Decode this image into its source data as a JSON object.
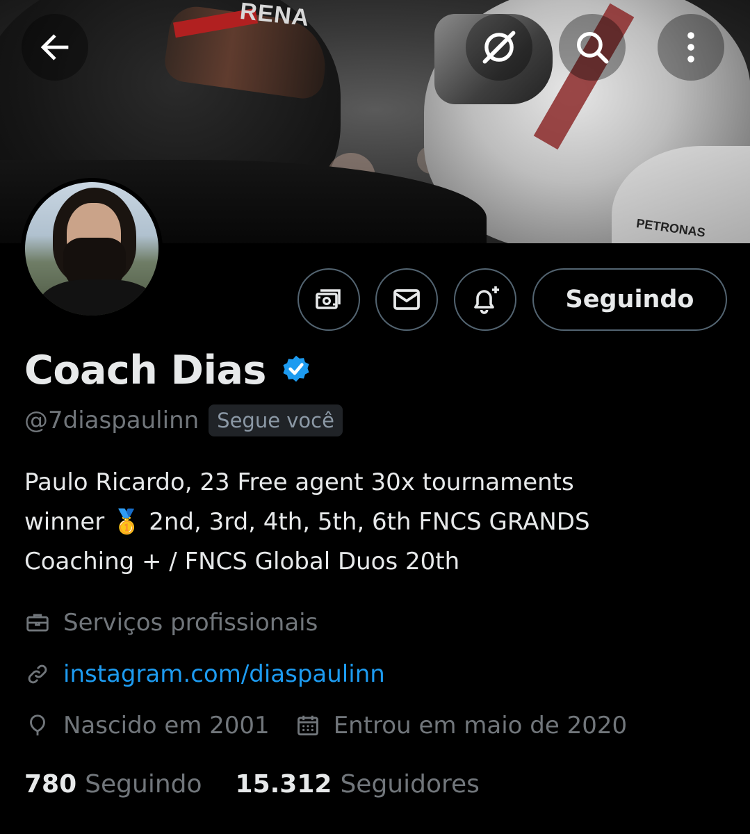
{
  "banner": {
    "sponsor_left": "RENA",
    "sponsor_right": "PETRONAS"
  },
  "profile": {
    "name": "Coach Dias",
    "verified": true,
    "handle": "@7diaspaulinn",
    "follows_you": "Segue você",
    "bio_lines": [
      "Paulo Ricardo, 23 Free agent 30x tournaments",
      "winner 🥇 2nd, 3rd, 4th, 5th, 6th FNCS GRANDS",
      "Coaching + / FNCS Global Duos 20th"
    ],
    "category": "Serviços profissionais",
    "link": "instagram.com/diaspaulinn",
    "born": "Nascido em 2001",
    "joined": "Entrou em maio de 2020"
  },
  "actions": {
    "follow_label": "Seguindo"
  },
  "stats": {
    "following_count": "780",
    "following_label": "Seguindo",
    "followers_count": "15.312",
    "followers_label": "Seguidores"
  },
  "colors": {
    "background": "#000000",
    "text": "#e7e9ea",
    "muted": "#71767b",
    "link": "#1d9bf0",
    "verified": "#1d9bf0",
    "border": "#536471"
  },
  "icons": {
    "back": "arrow-left-icon",
    "grok": "grok-icon",
    "search": "search-icon",
    "more": "more-vertical-icon",
    "subscribe": "money-icon",
    "message": "envelope-icon",
    "notify": "bell-plus-icon",
    "category": "briefcase-icon",
    "link": "link-icon",
    "born": "balloon-icon",
    "joined": "calendar-icon"
  }
}
